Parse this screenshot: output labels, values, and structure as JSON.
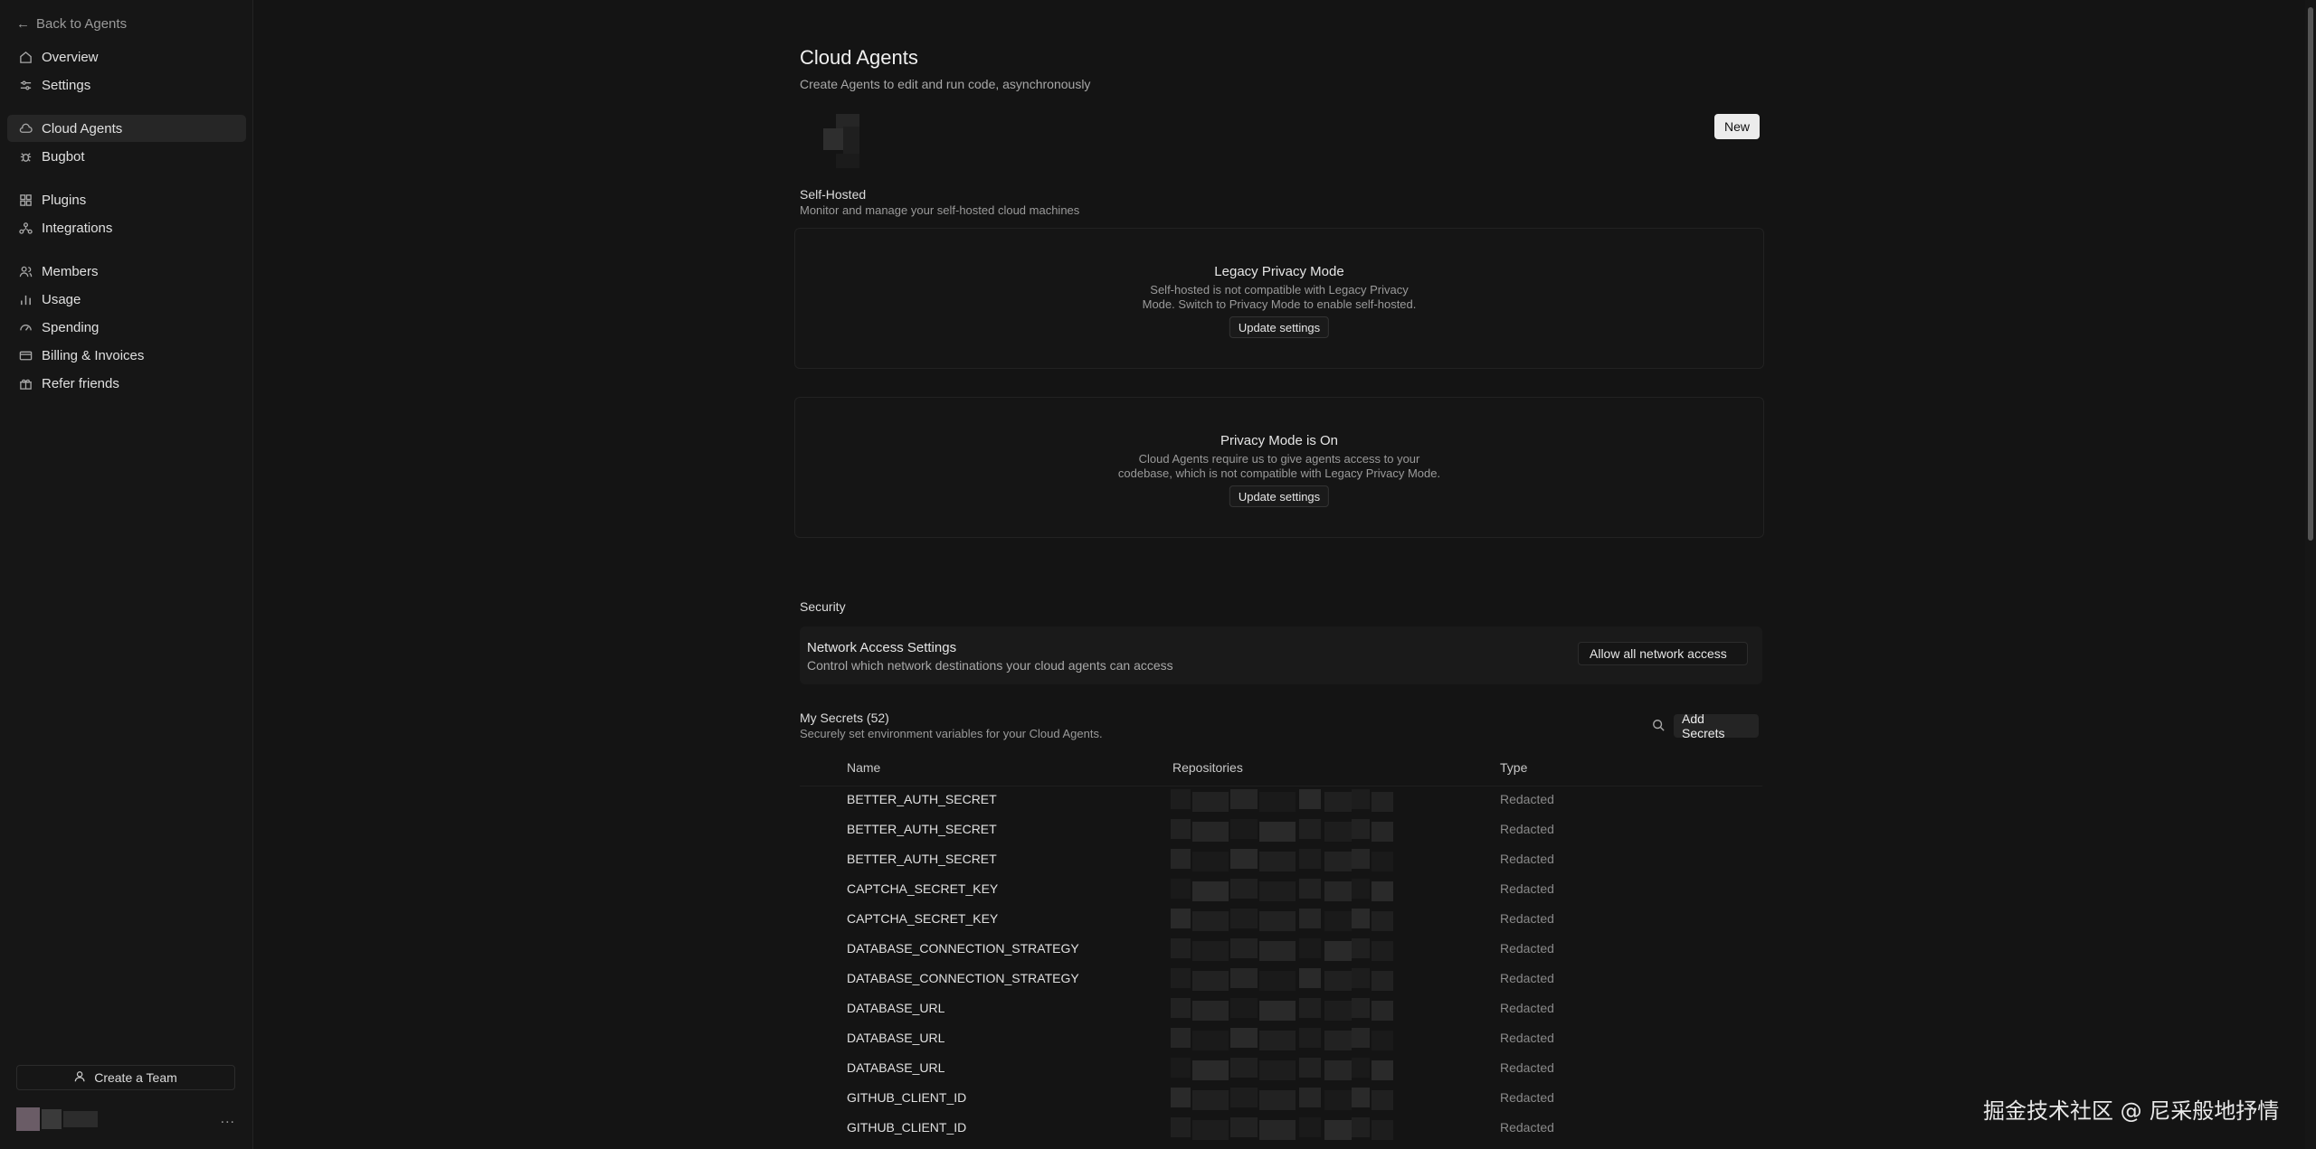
{
  "sidebar": {
    "back_label": "Back to Agents",
    "items": [
      {
        "label": "Overview",
        "icon": "home-icon"
      },
      {
        "label": "Settings",
        "icon": "sliders-icon"
      },
      {
        "label": "Cloud Agents",
        "icon": "cloud-icon",
        "active": true
      },
      {
        "label": "Bugbot",
        "icon": "bug-icon"
      },
      {
        "label": "Plugins",
        "icon": "plugin-icon"
      },
      {
        "label": "Integrations",
        "icon": "integrations-icon"
      },
      {
        "label": "Members",
        "icon": "users-icon"
      },
      {
        "label": "Usage",
        "icon": "bar-chart-icon"
      },
      {
        "label": "Spending",
        "icon": "gauge-icon"
      },
      {
        "label": "Billing & Invoices",
        "icon": "card-icon"
      },
      {
        "label": "Refer friends",
        "icon": "gift-icon"
      }
    ],
    "create_team_label": "Create a Team",
    "more_label": "..."
  },
  "header": {
    "title": "Cloud Agents",
    "subtitle": "Create Agents to edit and run code, asynchronously",
    "new_label": "New"
  },
  "self_hosted": {
    "title": "Self-Hosted",
    "description": "Monitor and manage your self-hosted cloud machines",
    "legacy_card": {
      "title": "Legacy Privacy Mode",
      "line1": "Self-hosted is not compatible with Legacy Privacy",
      "line2": "Mode. Switch to Privacy Mode to enable self-hosted.",
      "button": "Update settings"
    },
    "privacy_card": {
      "title": "Privacy Mode is On",
      "line1": "Cloud Agents require us to give agents access to your",
      "line2": "codebase, which is not compatible with Legacy Privacy Mode.",
      "button": "Update settings"
    }
  },
  "security": {
    "title": "Security",
    "network": {
      "title": "Network Access Settings",
      "description": "Control which network destinations your cloud agents can access",
      "value": "Allow all network access"
    }
  },
  "secrets": {
    "title": "My Secrets (52)",
    "description": "Securely set environment variables for your Cloud Agents.",
    "add_label": "Add Secrets",
    "columns": {
      "name": "Name",
      "repositories": "Repositories",
      "type": "Type"
    },
    "rows": [
      {
        "name": "BETTER_AUTH_SECRET",
        "type": "Redacted"
      },
      {
        "name": "BETTER_AUTH_SECRET",
        "type": "Redacted"
      },
      {
        "name": "BETTER_AUTH_SECRET",
        "type": "Redacted"
      },
      {
        "name": "CAPTCHA_SECRET_KEY",
        "type": "Redacted"
      },
      {
        "name": "CAPTCHA_SECRET_KEY",
        "type": "Redacted"
      },
      {
        "name": "DATABASE_CONNECTION_STRATEGY",
        "type": "Redacted"
      },
      {
        "name": "DATABASE_CONNECTION_STRATEGY",
        "type": "Redacted"
      },
      {
        "name": "DATABASE_URL",
        "type": "Redacted"
      },
      {
        "name": "DATABASE_URL",
        "type": "Redacted"
      },
      {
        "name": "DATABASE_URL",
        "type": "Redacted"
      },
      {
        "name": "GITHUB_CLIENT_ID",
        "type": "Redacted"
      },
      {
        "name": "GITHUB_CLIENT_ID",
        "type": "Redacted"
      }
    ]
  },
  "watermark": "掘金技术社区 @ 尼采般地抒情"
}
